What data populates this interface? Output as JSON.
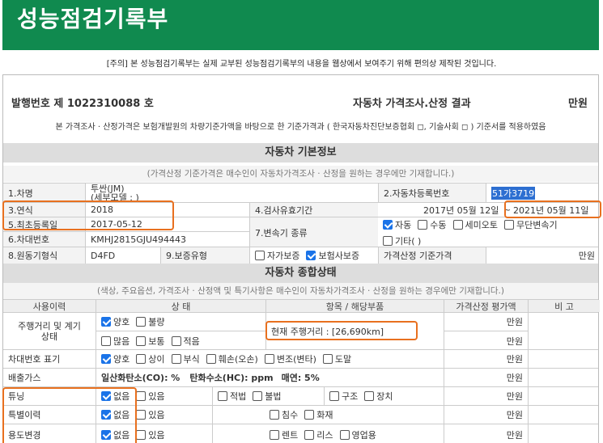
{
  "header": {
    "title": "성능점검기록부"
  },
  "notice": "[주의] 본 성능점검기록부는 실제 교부된 성능점검기록부의 내용을 웹상에서 보여주기 위해 편의상 제작된 것입니다.",
  "issue": {
    "number_label": "발행번호 제 1022310088 호",
    "result_label": "자동차 가격조사.산정 결과",
    "unit": "만원"
  },
  "basis_text": "본 가격조사 · 산정가격은 보험개발원의 차량기준가액을 바탕으로 한 기준가격과 ( 한국자동차진단보증협회 ◻, 기술사회 ◻ ) 기준서를 적용하였음",
  "basic_info": {
    "title": "자동차 기본정보",
    "note": "(가격산정 기준가격은 매수인이 자동차가격조사 · 산정을 원하는 경우에만 기재합니다.)",
    "car_name_label": "1.차명",
    "car_name_value": "투싼(JM)",
    "car_model_value": "(세부모델 : )",
    "reg_no_label": "2.자동차등록번호",
    "reg_no_value": "51가3719",
    "year_label": "3.연식",
    "year_value": "2018",
    "validity_label": "4.검사유효기간",
    "validity_start": "2017년 05월 12일",
    "validity_sep": "~",
    "validity_end": "2021년 05월 11일",
    "first_reg_label": "5.최초등록일",
    "first_reg_value": "2017-05-12",
    "transmission_label": "7.변속기 종류",
    "transmission_options": [
      {
        "label": "자동",
        "checked": true
      },
      {
        "label": "수동",
        "checked": false
      },
      {
        "label": "세미오토",
        "checked": false
      },
      {
        "label": "무단변속기",
        "checked": false
      },
      {
        "label": "기타( )",
        "checked": false
      }
    ],
    "vin_label": "6.차대번호",
    "vin_value": "KMHJ2815GJU494443",
    "engine_label": "8.원동기형식",
    "engine_value": "D4FD",
    "warranty_label": "9.보증유형",
    "warranty_options": [
      {
        "label": "자가보증",
        "checked": false
      },
      {
        "label": "보험사보증",
        "checked": true
      }
    ],
    "base_price_label": "가격산정 기준가격",
    "base_price_unit": "만원"
  },
  "status": {
    "title": "자동차 종합상태",
    "note": "(색상, 주요옵션, 가격조사 · 산정액 및 특기사항은 매수인이 자동차가격조사 · 산정을 원하는 경우에만 기재합니다.)",
    "headers": [
      "사용이력",
      "상 태",
      "항목 / 해당부품",
      "가격산정 평가액",
      "비 고"
    ],
    "mileage_label": "주행거리 및 계기상태",
    "mileage_row1": [
      {
        "label": "양호",
        "checked": true
      },
      {
        "label": "불량",
        "checked": false
      }
    ],
    "mileage_row2": [
      {
        "label": "많음",
        "checked": false
      },
      {
        "label": "보통",
        "checked": false
      },
      {
        "label": "적음",
        "checked": false
      }
    ],
    "mileage_value": "현재 주행거리 : [26,690km]",
    "vin_mark_label": "차대번호 표기",
    "vin_mark_options": [
      {
        "label": "양호",
        "checked": true
      },
      {
        "label": "상이",
        "checked": false
      },
      {
        "label": "부식",
        "checked": false
      },
      {
        "label": "훼손(오손)",
        "checked": false
      },
      {
        "label": "변조(변타)",
        "checked": false
      },
      {
        "label": "도말",
        "checked": false
      }
    ],
    "emission_label": "배출가스",
    "emission_co": "일산화탄소(CO): %",
    "emission_hc": "탄화수소(HC): ppm",
    "emission_smoke": "매연: 5%",
    "tuning_label": "튜닝",
    "tuning_state": [
      {
        "label": "없음",
        "checked": true
      },
      {
        "label": "있음",
        "checked": false
      }
    ],
    "tuning_legal": [
      {
        "label": "적법",
        "checked": false
      },
      {
        "label": "불법",
        "checked": false
      }
    ],
    "tuning_part": [
      {
        "label": "구조",
        "checked": false
      },
      {
        "label": "장치",
        "checked": false
      }
    ],
    "special_label": "특별이력",
    "special_state": [
      {
        "label": "없음",
        "checked": true
      },
      {
        "label": "있음",
        "checked": false
      }
    ],
    "special_items": [
      {
        "label": "침수",
        "checked": false
      },
      {
        "label": "화재",
        "checked": false
      }
    ],
    "use_change_label": "용도변경",
    "use_change_state": [
      {
        "label": "없음",
        "checked": true
      },
      {
        "label": "있음",
        "checked": false
      }
    ],
    "use_change_items": [
      {
        "label": "렌트",
        "checked": false
      },
      {
        "label": "리스",
        "checked": false
      },
      {
        "label": "영업용",
        "checked": false
      }
    ],
    "unit": "만원"
  },
  "colors": {
    "brand": "#108a4f",
    "highlight": "#e8701f",
    "check": "#1a73e8"
  }
}
